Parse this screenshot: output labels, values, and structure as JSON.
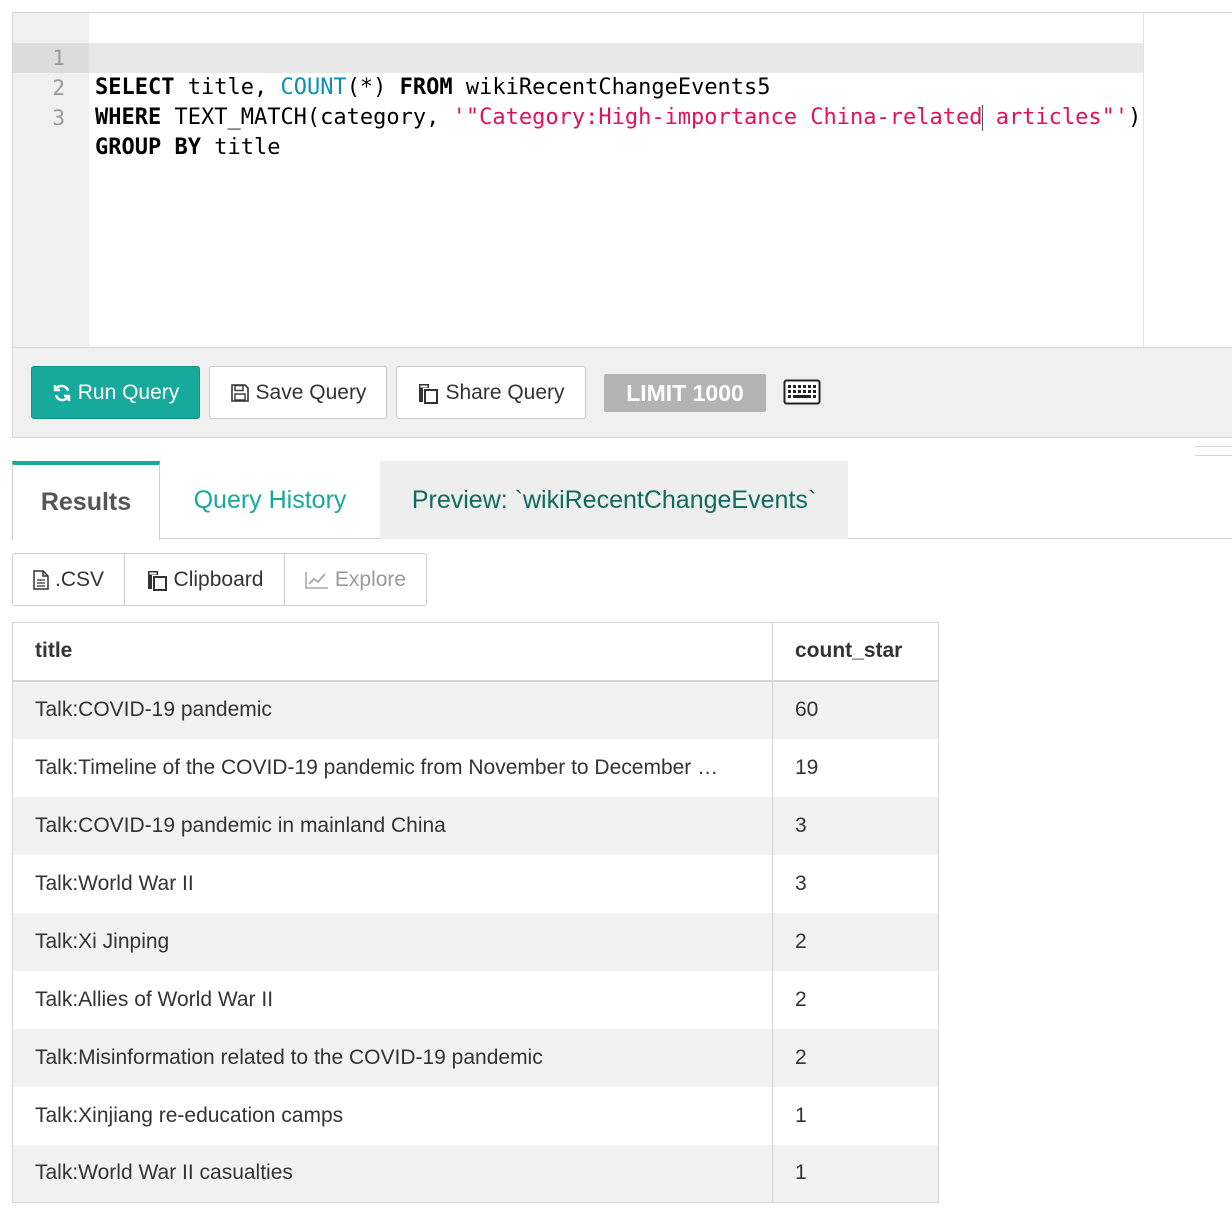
{
  "editor": {
    "line_numbers": [
      "1",
      "2",
      "3"
    ],
    "line1": {
      "kw1": "SELECT",
      "t1": " title, ",
      "fn": "COUNT",
      "t2": "(*) ",
      "kw2": "FROM",
      "t3": " wikiRecentChangeEvents5"
    },
    "line2": {
      "kw1": "WHERE",
      "t1": " TEXT_MATCH(category, ",
      "str1": "'\"Category:High-importance China-related",
      "str2": " articles\"'",
      "t2": ")"
    },
    "line3": {
      "kw1": "GROUP BY",
      "t1": " title"
    }
  },
  "toolbar": {
    "run_label": "Run Query",
    "save_label": "Save Query",
    "share_label": "Share Query",
    "limit_label": "LIMIT 1000"
  },
  "tabs": {
    "results": "Results",
    "history": "Query History",
    "preview": "Preview: `wikiRecentChangeEvents`"
  },
  "exports": {
    "csv": ".CSV",
    "clipboard": "Clipboard",
    "explore": "Explore"
  },
  "table": {
    "columns": [
      "title",
      "count_star"
    ],
    "rows": [
      [
        "Talk:COVID-19 pandemic",
        "60"
      ],
      [
        "Talk:Timeline of the COVID-19 pandemic from November to December …",
        "19"
      ],
      [
        "Talk:COVID-19 pandemic in mainland China",
        "3"
      ],
      [
        "Talk:World War II",
        "3"
      ],
      [
        "Talk:Xi Jinping",
        "2"
      ],
      [
        "Talk:Allies of World War II",
        "2"
      ],
      [
        "Talk:Misinformation related to the COVID-19 pandemic",
        "2"
      ],
      [
        "Talk:Xinjiang re-education camps",
        "1"
      ],
      [
        "Talk:World War II casualties",
        "1"
      ]
    ]
  },
  "colors": {
    "accent": "#16a99c",
    "keyword_fn": "#0b8fb3",
    "string": "#e0115f",
    "limit_bg": "#b3b3b3"
  },
  "icons": {
    "run": "refresh-icon",
    "save": "floppy-disk-icon",
    "share": "copy-icon",
    "keyboard": "keyboard-icon",
    "csv": "file-icon",
    "clipboard": "clipboard-icon",
    "explore": "line-chart-icon"
  }
}
